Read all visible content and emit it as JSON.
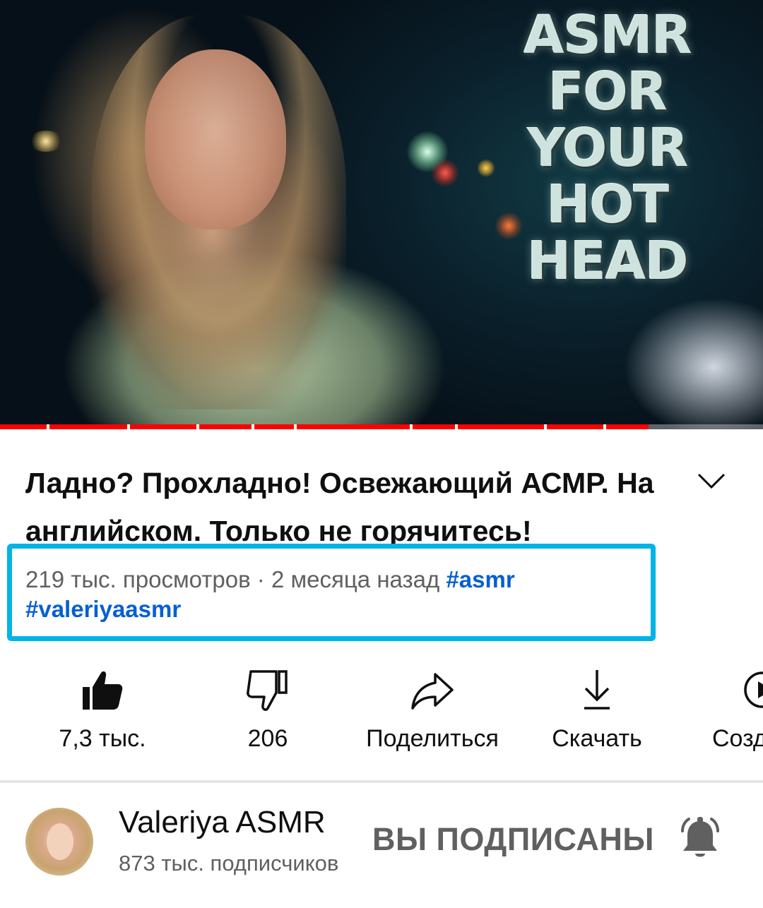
{
  "player": {
    "thumbnail_text": [
      "ASMR",
      "FOR",
      "YOUR",
      "HOT",
      "HEAD"
    ],
    "progress_fraction": 0.85,
    "accent_color": "#ff0000"
  },
  "video": {
    "title": "Ладно? Прохладно! Освежающий АСМР. На английском. Только не горячитесь!",
    "views": "219 тыс. просмотров",
    "separator": " · ",
    "age": "2 месяца назад",
    "hashtags": [
      "#asmr",
      "#valeriyaasmr"
    ]
  },
  "actions": {
    "like_count": "7,3 тыс.",
    "dislike_count": "206",
    "share_label": "Поделиться",
    "download_label": "Скачать",
    "create_label": "Создать"
  },
  "channel": {
    "name": "Valeriya ASMR",
    "subscribers": "873 тыс. подписчиков",
    "subscribed_label": "ВЫ ПОДПИСАНЫ"
  },
  "icons": {
    "like": "thumb-up-filled-icon",
    "dislike": "thumb-down-outline-icon",
    "share": "share-arrow-icon",
    "download": "download-icon",
    "create": "create-clip-icon",
    "bell": "notification-bell-icon",
    "expand": "chevron-down-icon"
  },
  "colors": {
    "highlight_border": "#00b4e6",
    "hashtag": "#065fd4"
  }
}
